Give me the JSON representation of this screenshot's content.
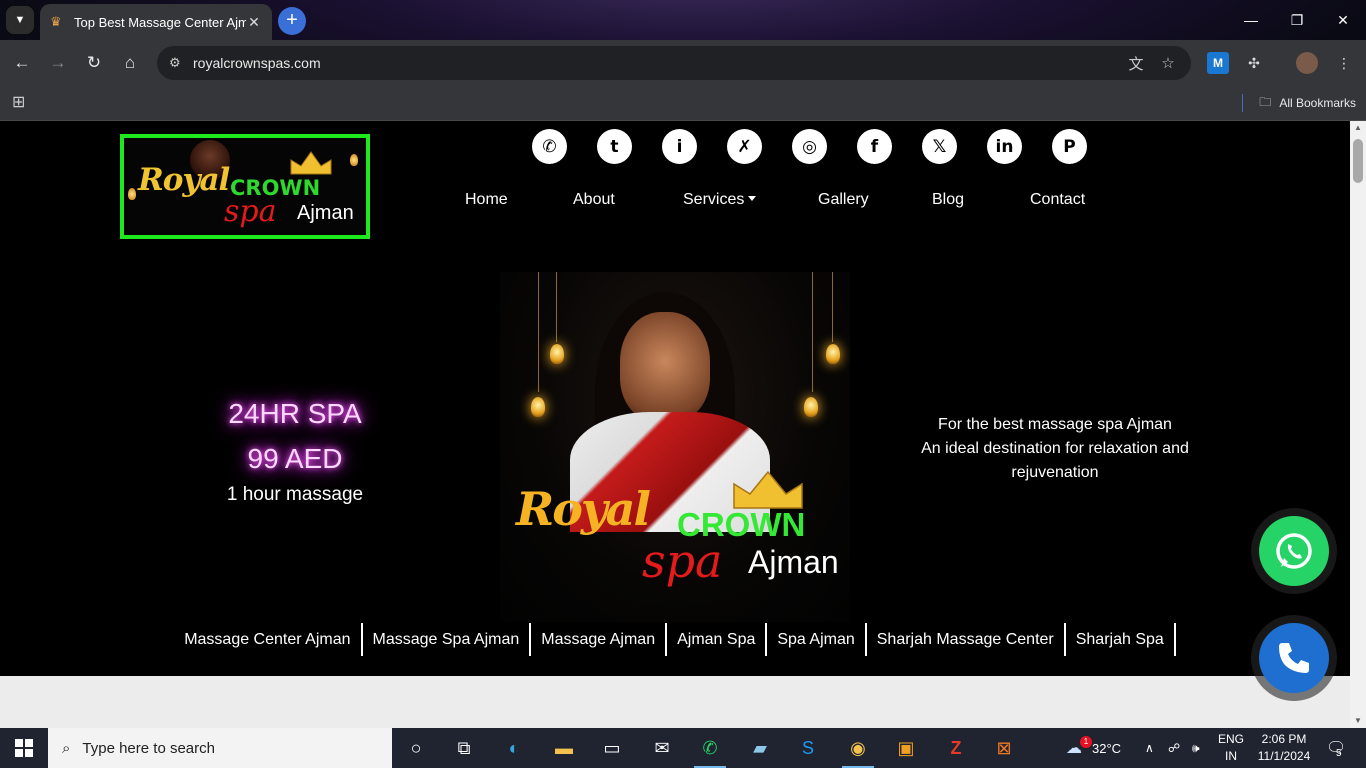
{
  "browser": {
    "tab_title": "Top Best Massage Center Ajman",
    "url": "royalcrownspas.com",
    "bookmarks_label": "All Bookmarks"
  },
  "site": {
    "logo": {
      "royal": "Royal",
      "crown": "CROWN",
      "spa": "spa",
      "ajman": "Ajman"
    },
    "socials": [
      "whatsapp-icon",
      "tumblr-icon",
      "info-icon",
      "xing-icon",
      "instagram-icon",
      "facebook-icon",
      "x-icon",
      "linkedin-icon",
      "pinterest-icon"
    ],
    "nav": {
      "home": "Home",
      "about": "About",
      "services": "Services",
      "gallery": "Gallery",
      "blog": "Blog",
      "contact": "Contact"
    },
    "hero_left": {
      "line1": "24HR SPA",
      "line2": "99 AED",
      "line3": "1 hour massage"
    },
    "hero_right": {
      "line1": "For the best massage spa Ajman",
      "line2": "An ideal destination for relaxation and rejuvenation"
    },
    "keywords": [
      "Massage Center Ajman",
      "Massage Spa Ajman",
      "Massage Ajman",
      "Ajman Spa",
      "Spa Ajman",
      "Sharjah Massage Center",
      "Sharjah Spa"
    ],
    "colors": {
      "logo_border": "#1ee81e",
      "whatsapp": "#25d366",
      "call": "#1e6fd0",
      "neon": "#e040fb"
    }
  },
  "taskbar": {
    "search_placeholder": "Type here to search",
    "weather": "32°C",
    "lang_top": "ENG",
    "lang_bottom": "IN",
    "time": "2:06 PM",
    "date": "11/1/2024",
    "notifications": "5",
    "mail_badge": "1"
  }
}
